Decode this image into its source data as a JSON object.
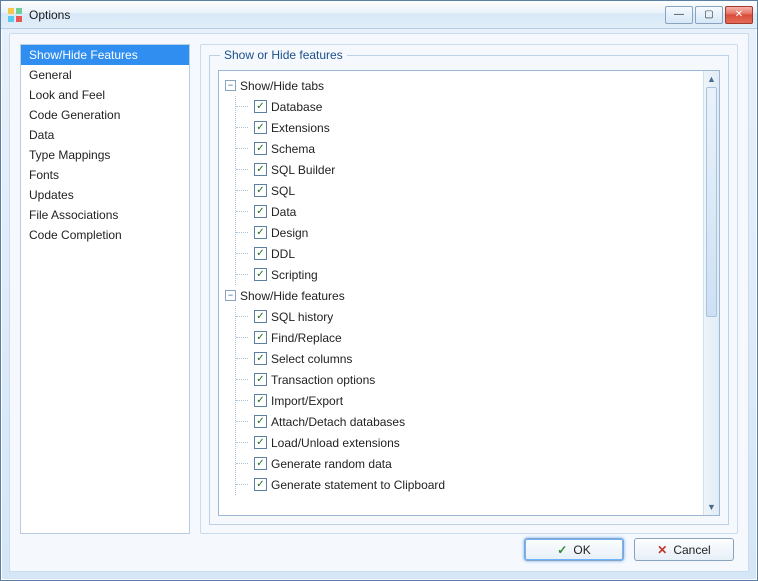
{
  "window": {
    "title": "Options"
  },
  "win_btns": {
    "min": "—",
    "max": "▢",
    "close": "✕"
  },
  "sidebar": {
    "items": [
      {
        "label": "Show/Hide Features",
        "selected": true
      },
      {
        "label": "General"
      },
      {
        "label": "Look and Feel"
      },
      {
        "label": "Code Generation"
      },
      {
        "label": "Data"
      },
      {
        "label": "Type Mappings"
      },
      {
        "label": "Fonts"
      },
      {
        "label": "Updates"
      },
      {
        "label": "File Associations"
      },
      {
        "label": "Code Completion"
      }
    ]
  },
  "panel": {
    "group_title": "Show or Hide features"
  },
  "tree": {
    "nodes": [
      {
        "label": "Show/Hide tabs",
        "expanded": true,
        "children": [
          {
            "label": "Database",
            "checked": true
          },
          {
            "label": "Extensions",
            "checked": true
          },
          {
            "label": "Schema",
            "checked": true
          },
          {
            "label": "SQL Builder",
            "checked": true
          },
          {
            "label": "SQL",
            "checked": true
          },
          {
            "label": "Data",
            "checked": true
          },
          {
            "label": "Design",
            "checked": true
          },
          {
            "label": "DDL",
            "checked": true
          },
          {
            "label": "Scripting",
            "checked": true
          }
        ]
      },
      {
        "label": "Show/Hide features",
        "expanded": true,
        "children": [
          {
            "label": "SQL history",
            "checked": true
          },
          {
            "label": "Find/Replace",
            "checked": true
          },
          {
            "label": "Select columns",
            "checked": true
          },
          {
            "label": "Transaction options",
            "checked": true
          },
          {
            "label": "Import/Export",
            "checked": true
          },
          {
            "label": "Attach/Detach databases",
            "checked": true
          },
          {
            "label": "Load/Unload extensions",
            "checked": true
          },
          {
            "label": "Generate random data",
            "checked": true
          },
          {
            "label": "Generate statement to Clipboard",
            "checked": true
          }
        ]
      }
    ]
  },
  "buttons": {
    "ok": "OK",
    "cancel": "Cancel"
  },
  "glyphs": {
    "minus": "−",
    "check": "✓",
    "up": "▲",
    "down": "▼"
  }
}
